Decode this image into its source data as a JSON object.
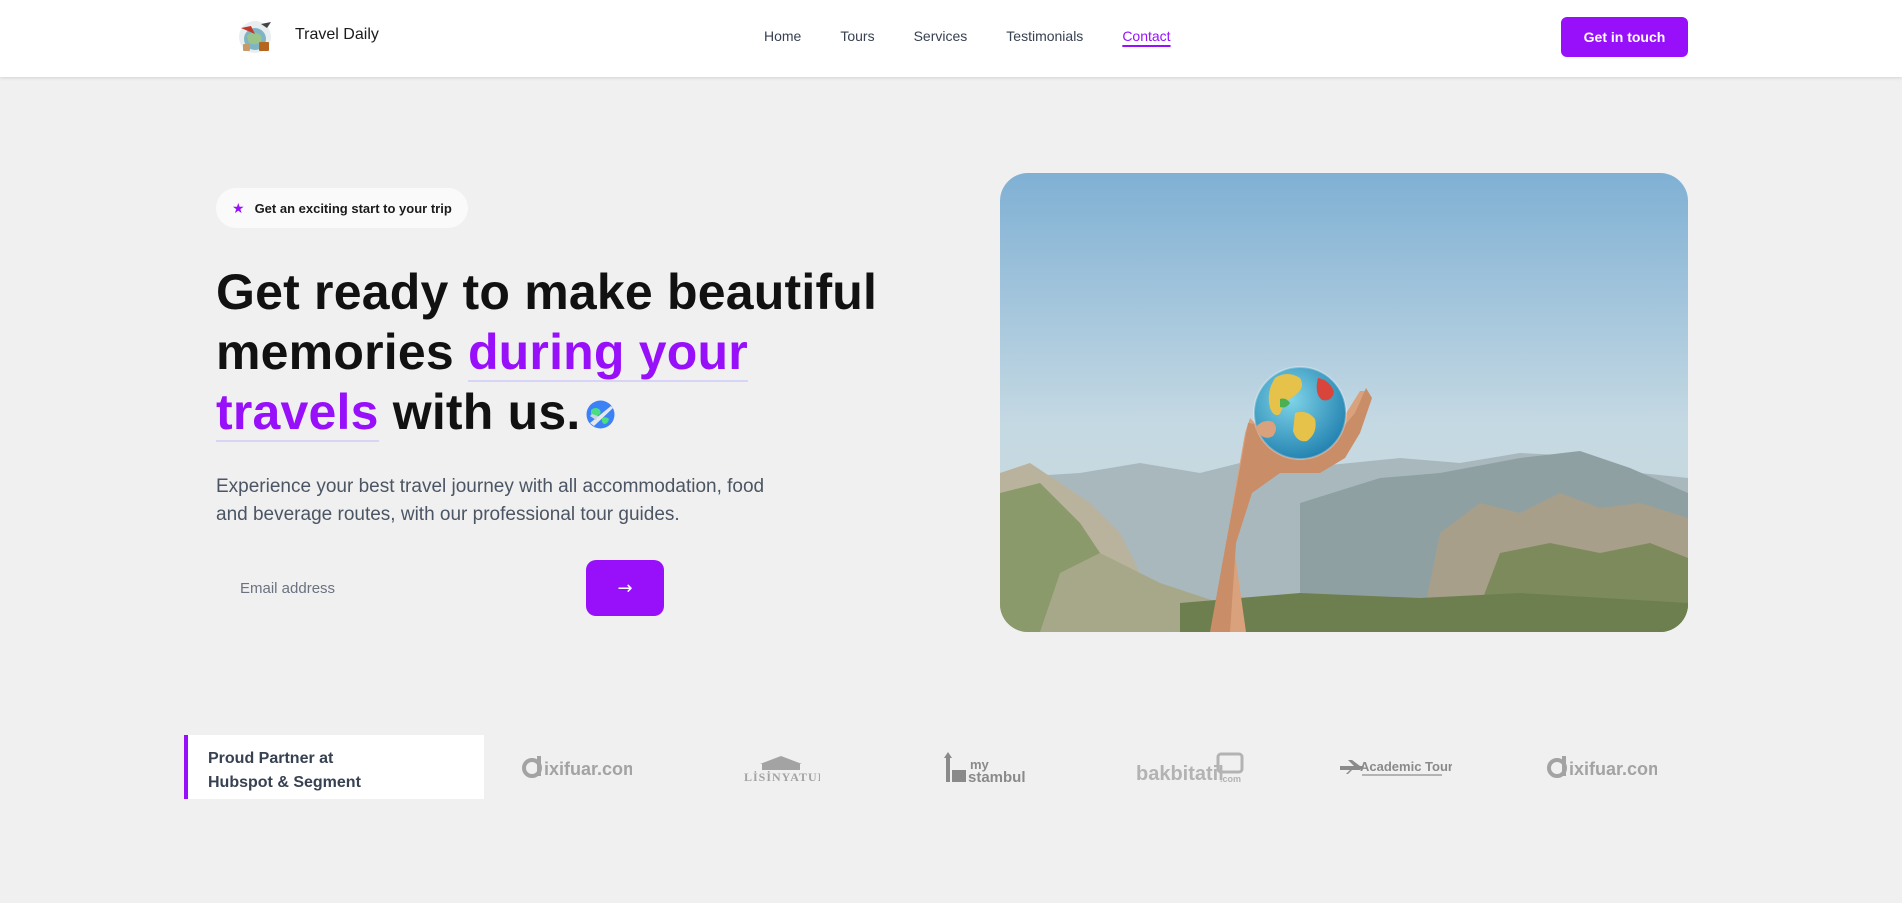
{
  "header": {
    "brand": "Travel Daily",
    "nav": [
      "Home",
      "Tours",
      "Services",
      "Testimonials",
      "Contact"
    ],
    "active_nav": "Contact",
    "cta_label": "Get in touch"
  },
  "hero": {
    "badge_text": "Get an exciting start to your trip",
    "headline_part1": "Get ready to make beautiful memories ",
    "headline_accent": "during your travels",
    "headline_part2": " with us.",
    "subtext": "Experience your best travel journey with all accommodation, food and beverage routes, with our professional tour guides.",
    "email_placeholder": "Email address",
    "submit_label": "→"
  },
  "partners": {
    "label_line1": "Proud Partner at",
    "label_line2": "Hubspot & Segment",
    "logos": [
      "dixifuar.com",
      "LİSİNYATUR",
      "my stambul",
      "bakbitatil.com",
      "Academic Tour",
      "dixifuar.com"
    ]
  },
  "colors": {
    "accent": "#9810fa",
    "background": "#f0f0f0"
  }
}
